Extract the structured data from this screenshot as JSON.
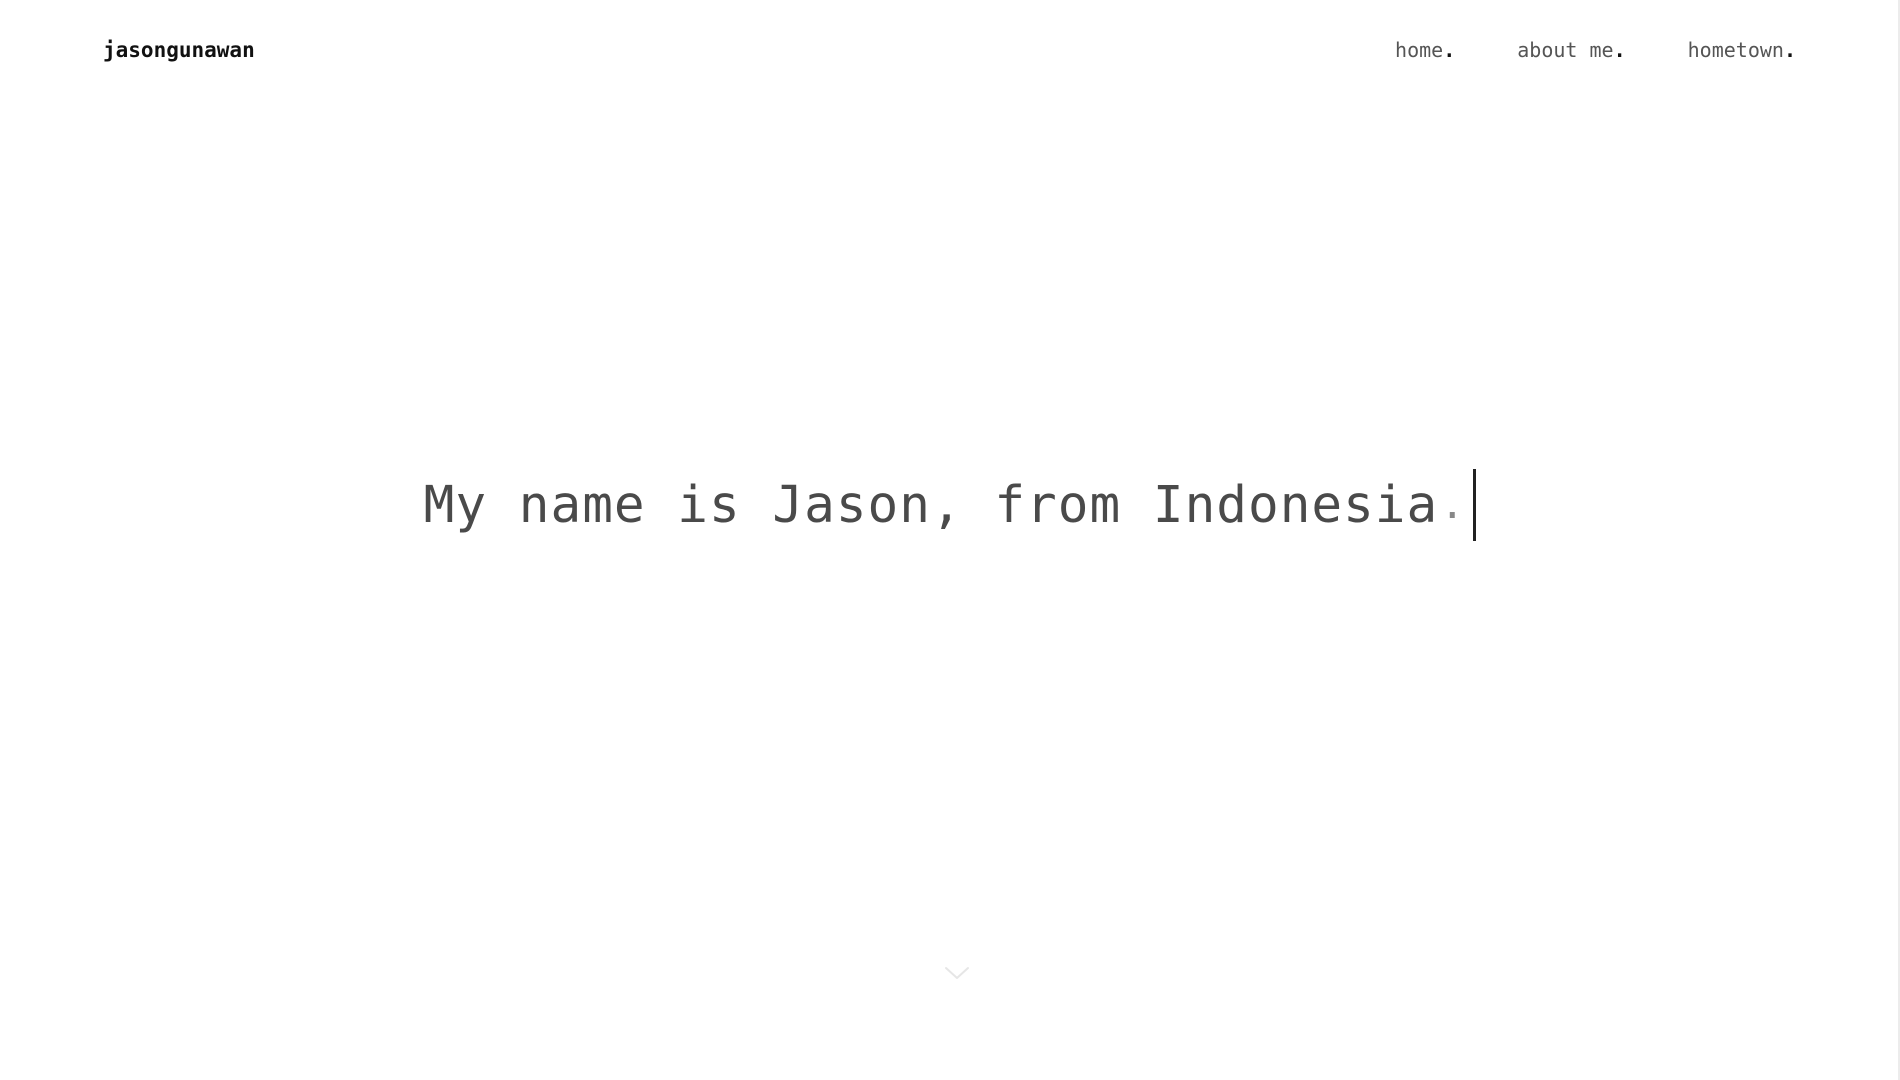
{
  "header": {
    "brand": "jasongunawan",
    "nav": [
      {
        "label": "home",
        "dot": "."
      },
      {
        "label": "about me",
        "dot": "."
      },
      {
        "label": "hometown",
        "dot": "."
      }
    ]
  },
  "hero": {
    "text": "My name is Jason, from Indonesia",
    "punct": "."
  },
  "colors": {
    "background": "#ffffff",
    "brand": "#111111",
    "nav_text": "#555555",
    "hero_text": "#4a4a4a",
    "caret": "#222222",
    "scroll_indicator": "#e6e6e6"
  },
  "icons": {
    "scroll": "chevron-down-icon"
  }
}
